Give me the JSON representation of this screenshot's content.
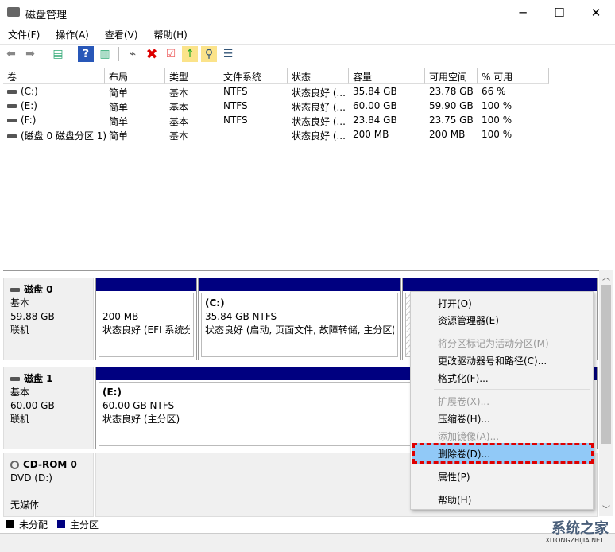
{
  "window": {
    "title": "磁盘管理",
    "minimize": "─",
    "maximize": "☐",
    "close": "✕"
  },
  "menu": [
    "文件(F)",
    "操作(A)",
    "查看(V)",
    "帮助(H)"
  ],
  "table": {
    "headers": [
      "卷",
      "布局",
      "类型",
      "文件系统",
      "状态",
      "容量",
      "可用空间",
      "% 可用"
    ],
    "rows": [
      [
        "(C:)",
        "简单",
        "基本",
        "NTFS",
        "状态良好 (...",
        "35.84 GB",
        "23.78 GB",
        "66 %"
      ],
      [
        "(E:)",
        "简单",
        "基本",
        "NTFS",
        "状态良好 (...",
        "60.00 GB",
        "59.90 GB",
        "100 %"
      ],
      [
        "(F:)",
        "简单",
        "基本",
        "NTFS",
        "状态良好 (...",
        "23.84 GB",
        "23.75 GB",
        "100 %"
      ],
      [
        "(磁盘 0 磁盘分区 1)",
        "简单",
        "基本",
        "",
        "状态良好 (...",
        "200 MB",
        "200 MB",
        "100 %"
      ]
    ]
  },
  "disks": [
    {
      "name": "磁盘 0",
      "type": "基本",
      "size": "59.88 GB",
      "status": "联机",
      "partitions": [
        {
          "title": "",
          "line1": "200 MB",
          "line2": "状态良好 (EFI 系统分"
        },
        {
          "title": "(C:)",
          "line1": "35.84 GB NTFS",
          "line2": "状态良好 (启动, 页面文件, 故障转储, 主分区)"
        },
        {
          "title": "",
          "line1": "",
          "line2": ""
        }
      ]
    },
    {
      "name": "磁盘 1",
      "type": "基本",
      "size": "60.00 GB",
      "status": "联机",
      "partitions": [
        {
          "title": "(E:)",
          "line1": "60.00 GB NTFS",
          "line2": "状态良好 (主分区)"
        }
      ]
    },
    {
      "name": "CD-ROM 0",
      "type": "DVD (D:)",
      "status": "无媒体"
    }
  ],
  "context_menu": [
    {
      "label": "打开(O)",
      "enabled": true
    },
    {
      "label": "资源管理器(E)",
      "enabled": true
    },
    {
      "label": "将分区标记为活动分区(M)",
      "enabled": false
    },
    {
      "label": "更改驱动器号和路径(C)...",
      "enabled": true
    },
    {
      "label": "格式化(F)...",
      "enabled": true
    },
    {
      "label": "扩展卷(X)...",
      "enabled": false
    },
    {
      "label": "压缩卷(H)...",
      "enabled": true
    },
    {
      "label": "添加镜像(A)...",
      "enabled": false
    },
    {
      "label": "删除卷(D)...",
      "enabled": true,
      "highlighted": true
    },
    {
      "label": "属性(P)",
      "enabled": true
    },
    {
      "label": "帮助(H)",
      "enabled": true
    }
  ],
  "legend": [
    {
      "label": "未分配",
      "color": "#000000"
    },
    {
      "label": "主分区",
      "color": "#000080"
    }
  ],
  "watermark": {
    "text": "系统之家",
    "url": "XITONGZHIJIA.NET"
  }
}
